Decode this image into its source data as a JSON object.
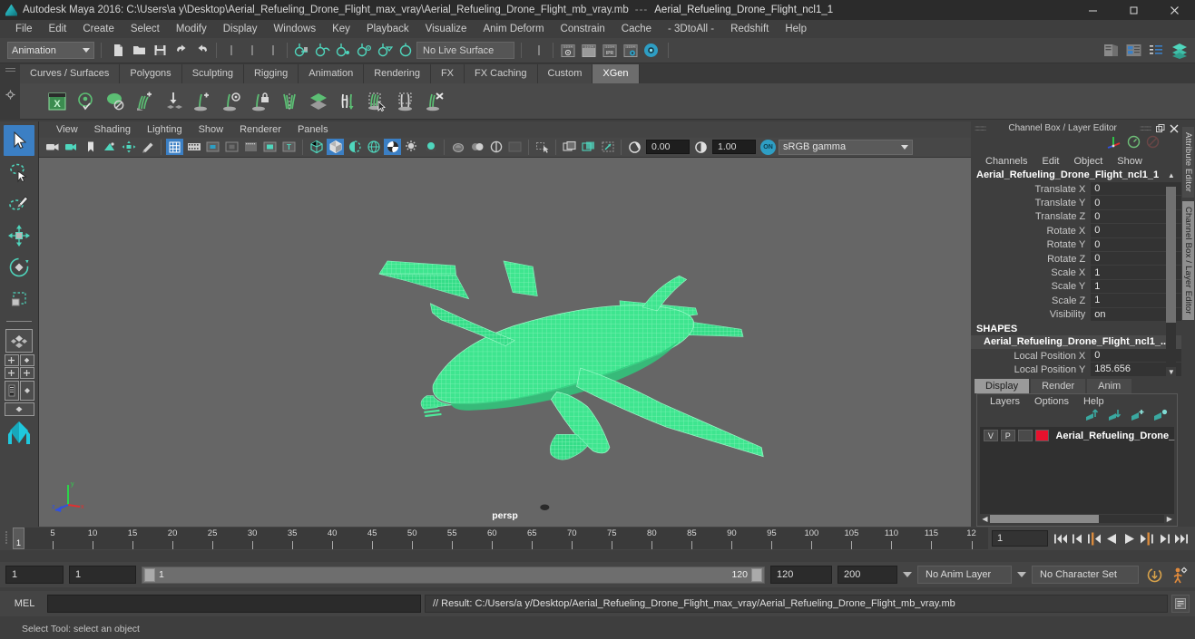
{
  "window": {
    "app_title": "Autodesk Maya 2016: C:\\Users\\a y\\Desktop\\Aerial_Refueling_Drone_Flight_max_vray\\Aerial_Refueling_Drone_Flight_mb_vray.mb",
    "separator": "---",
    "object_title": "Aerial_Refueling_Drone_Flight_ncl1_1",
    "minimize": "–",
    "restore": "❐",
    "close": "✕"
  },
  "menubar": {
    "items": [
      "File",
      "Edit",
      "Create",
      "Select",
      "Modify",
      "Display",
      "Windows",
      "Key",
      "Playback",
      "Visualize",
      "Anim Deform",
      "Constrain",
      "Cache",
      "- 3DtoAll -",
      "Redshift",
      "Help"
    ]
  },
  "statusline": {
    "menu_set": "Animation",
    "live_surface": "No Live Surface",
    "icons": [
      "new-scene-icon",
      "open-scene-icon",
      "save-scene-icon",
      "undo-icon",
      "redo-icon",
      "select-by-hierarchy-icon",
      "select-by-object-icon",
      "select-by-component-icon",
      "snap-to-grid-icon",
      "snap-to-curve-icon",
      "snap-to-point-icon",
      "snap-to-projected-center-icon",
      "snap-to-view-plane-icon",
      "make-live-icon"
    ],
    "right_icons": [
      "render-view-icon",
      "render-current-frame-icon",
      "ipr-render-icon",
      "render-settings-icon",
      "hypershade-icon",
      "sidebar-attribute-editor-icon",
      "sidebar-tool-settings-icon",
      "sidebar-channel-box-icon",
      "sidebar-layer-editor-icon"
    ],
    "render_labels": [
      "1 2 3 4",
      "1 2 3 4",
      "IPR",
      "1 2 3 4"
    ]
  },
  "shelf": {
    "tabs": [
      "Curves / Surfaces",
      "Polygons",
      "Sculpting",
      "Rigging",
      "Animation",
      "Rendering",
      "FX",
      "FX Caching",
      "Custom",
      "XGen"
    ],
    "active_tab": "XGen",
    "icons": [
      "xgen-editor-icon",
      "xgen-preview-icon",
      "xgen-disable-preview-icon",
      "xgen-add-clump-icon",
      "xgen-place-guide-icon",
      "xgen-add-guide-icon",
      "xgen-guide-visibility-icon",
      "xgen-lock-guide-icon",
      "xgen-mirror-guide-icon",
      "xgen-layers-icon",
      "xgen-sculpt-guide-icon",
      "xgen-select-guide-icon",
      "xgen-region-icon",
      "xgen-delete-guide-icon"
    ]
  },
  "toolbox": {
    "tools": [
      {
        "name": "select-tool",
        "active": true
      },
      {
        "name": "lasso-select-tool",
        "active": false
      },
      {
        "name": "paint-select-tool",
        "active": false
      },
      {
        "name": "move-tool",
        "active": false
      },
      {
        "name": "rotate-tool",
        "active": false
      },
      {
        "name": "scale-tool",
        "active": false
      }
    ],
    "layouts": [
      "single-pane-layout",
      "four-pane-layout",
      "persp-outliner-layout",
      "persp-graph-layout",
      "hypershade-layout"
    ]
  },
  "viewport": {
    "menus": [
      "View",
      "Shading",
      "Lighting",
      "Show",
      "Renderer",
      "Panels"
    ],
    "exposure": "0.00",
    "gamma_value": "1.00",
    "color_management": "sRGB gamma",
    "gamma_toggle": "ON",
    "camera_label": "persp",
    "axis_labels": {
      "x": "x",
      "y": "y",
      "z": "z"
    },
    "model": "aerial-refueling-drone-wireframe",
    "wireframe_color": "#3ee58f",
    "background_color": "#666666"
  },
  "channel_box": {
    "panel_title": "Channel Box / Layer Editor",
    "menus": [
      "Channels",
      "Edit",
      "Object",
      "Show"
    ],
    "object_name": "Aerial_Refueling_Drone_Flight_ncl1_1",
    "attributes": [
      {
        "label": "Translate X",
        "value": "0"
      },
      {
        "label": "Translate Y",
        "value": "0"
      },
      {
        "label": "Translate Z",
        "value": "0"
      },
      {
        "label": "Rotate X",
        "value": "0"
      },
      {
        "label": "Rotate Y",
        "value": "0"
      },
      {
        "label": "Rotate Z",
        "value": "0"
      },
      {
        "label": "Scale X",
        "value": "1"
      },
      {
        "label": "Scale Y",
        "value": "1"
      },
      {
        "label": "Scale Z",
        "value": "1"
      },
      {
        "label": "Visibility",
        "value": "on"
      }
    ],
    "shapes_header": "SHAPES",
    "shape_name": "Aerial_Refueling_Drone_Flight_ncl1_...",
    "shape_attributes": [
      {
        "label": "Local Position X",
        "value": "0"
      },
      {
        "label": "Local Position Y",
        "value": "185.656"
      }
    ]
  },
  "layer_editor": {
    "tabs": [
      "Display",
      "Render",
      "Anim"
    ],
    "active_tab": "Display",
    "menus": [
      "Layers",
      "Options",
      "Help"
    ],
    "icon_names": [
      "move-layer-up-icon",
      "move-layer-down-icon",
      "new-layer-icon",
      "new-layer-from-selected-icon"
    ],
    "layers": [
      {
        "visibility": "V",
        "playback": "P",
        "shading": "",
        "color": "#e8112d",
        "name": "Aerial_Refueling_Drone_"
      }
    ]
  },
  "timeslider": {
    "current_frame": "1",
    "tick_labels": [
      "5",
      "10",
      "15",
      "20",
      "25",
      "30",
      "35",
      "40",
      "45",
      "50",
      "55",
      "60",
      "65",
      "70",
      "75",
      "80",
      "85",
      "90",
      "95",
      "100",
      "105",
      "110",
      "115",
      "12"
    ],
    "current_time_field": "1",
    "playback_buttons": [
      "go-to-start-icon",
      "step-back-keyframe-icon",
      "step-back-frame-icon",
      "play-backwards-icon",
      "play-forwards-icon",
      "step-forward-frame-icon",
      "step-forward-keyframe-icon",
      "go-to-end-icon"
    ]
  },
  "rangeslider": {
    "anim_start": "1",
    "range_start": "1",
    "track_left_label": "1",
    "track_right_label": "120",
    "range_end": "120",
    "anim_end": "200",
    "anim_layer": "No Anim Layer",
    "character_set": "No Character Set",
    "icons": [
      "auto-keyframe-icon",
      "animation-preferences-icon"
    ]
  },
  "commandline": {
    "mel_label": "MEL",
    "input_value": "",
    "result_text": "// Result: C:/Users/a y/Desktop/Aerial_Refueling_Drone_Flight_max_vray/Aerial_Refueling_Drone_Flight_mb_vray.mb",
    "script_editor_icon": "script-editor-icon"
  },
  "helpline": {
    "text": "Select Tool: select an object"
  },
  "colors": {
    "accent_blue": "#3b7fc4",
    "teal": "#2e9ec4",
    "shelf_green": "#4aa564",
    "layer_red": "#e8112d",
    "wire_green": "#3ee58f"
  }
}
